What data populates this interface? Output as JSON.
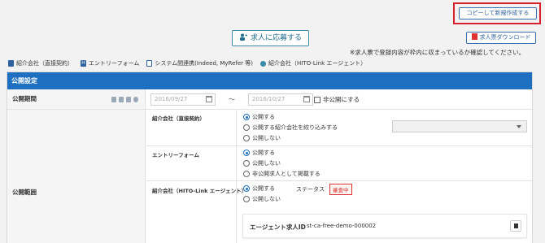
{
  "header": {
    "copy_button": "コピーして新規作成する",
    "apply_button": "求人に応募する",
    "download_button": "求人票ダウンロード",
    "note": "※求人票で登録内容が枠内に収まっているか確認してください。"
  },
  "legend": [
    {
      "icon": "building-icon",
      "label": "紹介会社（直接契約）"
    },
    {
      "icon": "h-icon",
      "label": "エントリーフォーム"
    },
    {
      "icon": "link-icon",
      "label": "システム間連携(Indeed, MyRefer 等)"
    },
    {
      "icon": "person-icon",
      "label": "紹介会社（HITO-Link エージェント）"
    }
  ],
  "panel": {
    "title": "公開設定",
    "period_label": "公開期間",
    "start_date": "2016/09/27",
    "end_date": "2016/10/27",
    "tilde": "〜",
    "private_checkbox": "非公開にする",
    "scope_label": "公開範囲",
    "sections": [
      {
        "label": "紹介会社（直接契約）",
        "options": [
          "公開する",
          "公開する紹介会社を絞り込みする",
          "公開しない"
        ],
        "selected": 0
      },
      {
        "label": "エントリーフォーム",
        "options": [
          "公開する",
          "公開しない",
          "非公開求人として掲載する"
        ],
        "selected": 0
      },
      {
        "label": "紹介会社（HITO-Link エージェント）",
        "options": [
          "公開する",
          "公開しない"
        ],
        "selected": 0,
        "status_label": "ステータス",
        "status_value": "審査中",
        "agent_id_label": "エージェント求人ID",
        "agent_id_value": "st-ca-free-demo-000002"
      }
    ]
  },
  "colors": {
    "accent": "#1e6fbf",
    "highlight_border": "#d6202a",
    "status": "#dd3333"
  }
}
